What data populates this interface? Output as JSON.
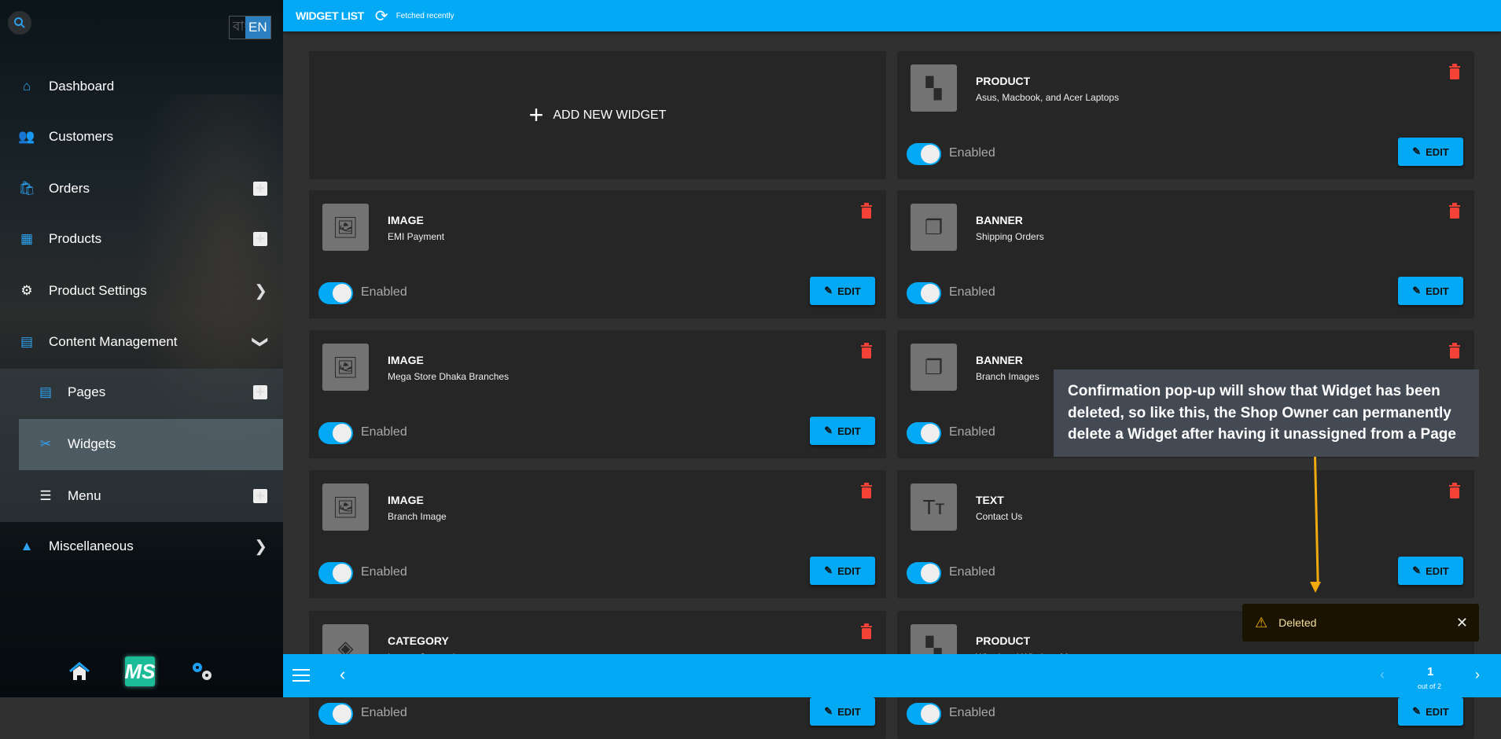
{
  "sidebar": {
    "lang": {
      "bn": "বাং",
      "en": "EN"
    },
    "items": [
      {
        "label": "Dashboard",
        "icon": "home-icon"
      },
      {
        "label": "Customers",
        "icon": "users-icon"
      },
      {
        "label": "Orders",
        "icon": "bag-icon"
      },
      {
        "label": "Products",
        "icon": "boxes-icon"
      },
      {
        "label": "Product Settings",
        "icon": "gear-icon"
      },
      {
        "label": "Content Management",
        "icon": "newspaper-icon"
      },
      {
        "label": "Pages",
        "icon": "newspaper-icon"
      },
      {
        "label": "Widgets",
        "icon": "tools-icon"
      },
      {
        "label": "Menu",
        "icon": "list-icon"
      },
      {
        "label": "Miscellaneous",
        "icon": "shapes-icon"
      }
    ],
    "logo": "MS"
  },
  "header": {
    "title": "WIDGET LIST",
    "status": "Fetched recently"
  },
  "add_widget": "ADD NEW WIDGET",
  "toggle_label": "Enabled",
  "edit_label": "EDIT",
  "widgets": [
    {
      "type": "PRODUCT",
      "name": "Asus, Macbook, and Acer Laptops"
    },
    {
      "type": "IMAGE",
      "name": "EMI Payment"
    },
    {
      "type": "BANNER",
      "name": "Shipping Orders"
    },
    {
      "type": "IMAGE",
      "name": "Mega Store Dhaka Branches"
    },
    {
      "type": "BANNER",
      "name": "Branch Images"
    },
    {
      "type": "IMAGE",
      "name": "Branch Image"
    },
    {
      "type": "TEXT",
      "name": "Contact Us"
    },
    {
      "type": "CATEGORY",
      "name": "Laptop Categories"
    },
    {
      "type": "PRODUCT",
      "name": "Wired and Wireless Mouse"
    }
  ],
  "pagination": {
    "page": "1",
    "total": "out of 2"
  },
  "callout": "Confirmation pop-up will show that Widget has been deleted, so like this, the Shop Owner can permanently delete a Widget after having it unassigned from a Page",
  "toast": {
    "message": "Deleted"
  },
  "colors": {
    "accent": "#03a9f4",
    "danger": "#f44336",
    "callout_arrow": "#f0a90e"
  }
}
